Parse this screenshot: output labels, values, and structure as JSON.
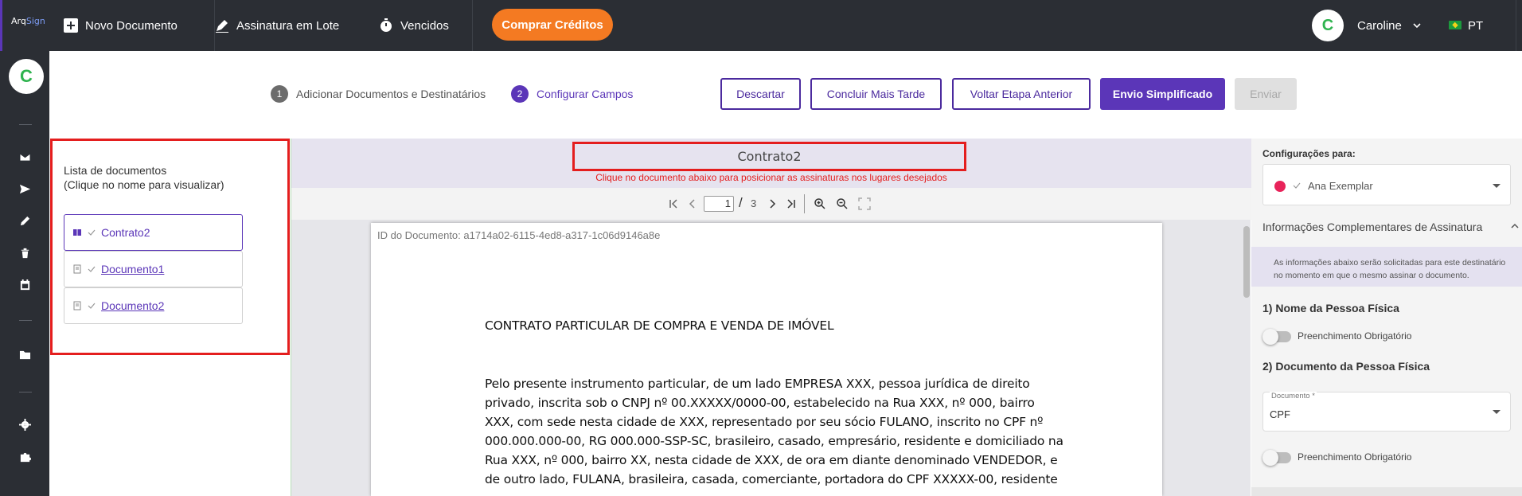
{
  "brand": {
    "logo_prefix": "Arq",
    "logo_suffix": "Sign"
  },
  "rail": {
    "avatar_initial": "C"
  },
  "topbar": {
    "new_doc": "Novo Documento",
    "batch_sign": "Assinatura em Lote",
    "expired": "Vencidos",
    "buy_credits": "Comprar Créditos",
    "user_initial": "C",
    "user_name": "Caroline",
    "language": "PT"
  },
  "steps": [
    {
      "num": "1",
      "label": "Adicionar Documentos e Destinatários"
    },
    {
      "num": "2",
      "label": "Configurar Campos"
    }
  ],
  "actions": {
    "discard": "Descartar",
    "finish_later": "Concluir Mais Tarde",
    "back": "Voltar Etapa Anterior",
    "simplified": "Envio Simplificado",
    "send": "Enviar"
  },
  "doclist": {
    "title_line1": "Lista de documentos",
    "title_line2": "(Clique no nome para visualizar)",
    "items": [
      {
        "name": "Contrato2",
        "active": true
      },
      {
        "name": "Documento1",
        "active": false
      },
      {
        "name": "Documento2",
        "active": false
      }
    ]
  },
  "viewer": {
    "doc_title": "Contrato2",
    "hint": "Clique no documento abaixo para posicionar as assinaturas nos lugares desejados",
    "current_page": "1",
    "total_pages": "3",
    "doc_id": "ID do Documento: a1714a02-6115-4ed8-a317-1c06d9146a8e",
    "heading": "CONTRATO PARTICULAR DE COMPRA E VENDA DE IMÓVEL",
    "body_lines": [
      "Pelo presente instrumento particular, de um lado EMPRESA XXX, pessoa jurídica de direito",
      "privado, inscrita sob o CNPJ nº 00.XXXXX/0000-00, estabelecido na Rua XXX, nº 000, bairro",
      "XXX, com sede nesta cidade de XXX, representado por seu sócio FULANO, inscrito no CPF nº",
      "000.000.000-00, RG 000.000-SSP-SC, brasileiro, casado, empresário, residente e domiciliado na",
      "Rua XXX, nº 000, bairro XX, nesta cidade de XXX, de ora em diante denominado VENDEDOR, e",
      "de outro lado, FULANA, brasileira, casada, comerciante, portadora do CPF XXXXX-00, residente"
    ]
  },
  "config": {
    "label": "Configurações para:",
    "recipient": "Ana Exemplar",
    "recipient_color": "#e8235a",
    "accordion_title": "Informações Complementares de Assinatura",
    "info_line1": "As informações abaixo serão solicitadas para este destinatário",
    "info_line2": "no momento em que o mesmo assinar o documento.",
    "section1": "1) Nome da Pessoa Física",
    "mandatory1": "Preenchimento Obrigatório",
    "section2": "2) Documento da Pessoa Física",
    "doc_field_label": "Documento *",
    "doc_field_value": "CPF",
    "mandatory2": "Preenchimento Obrigatório"
  },
  "colors": {
    "accent": "#5b36b8",
    "orange": "#f47a22",
    "highlight": "#e41e1e"
  }
}
